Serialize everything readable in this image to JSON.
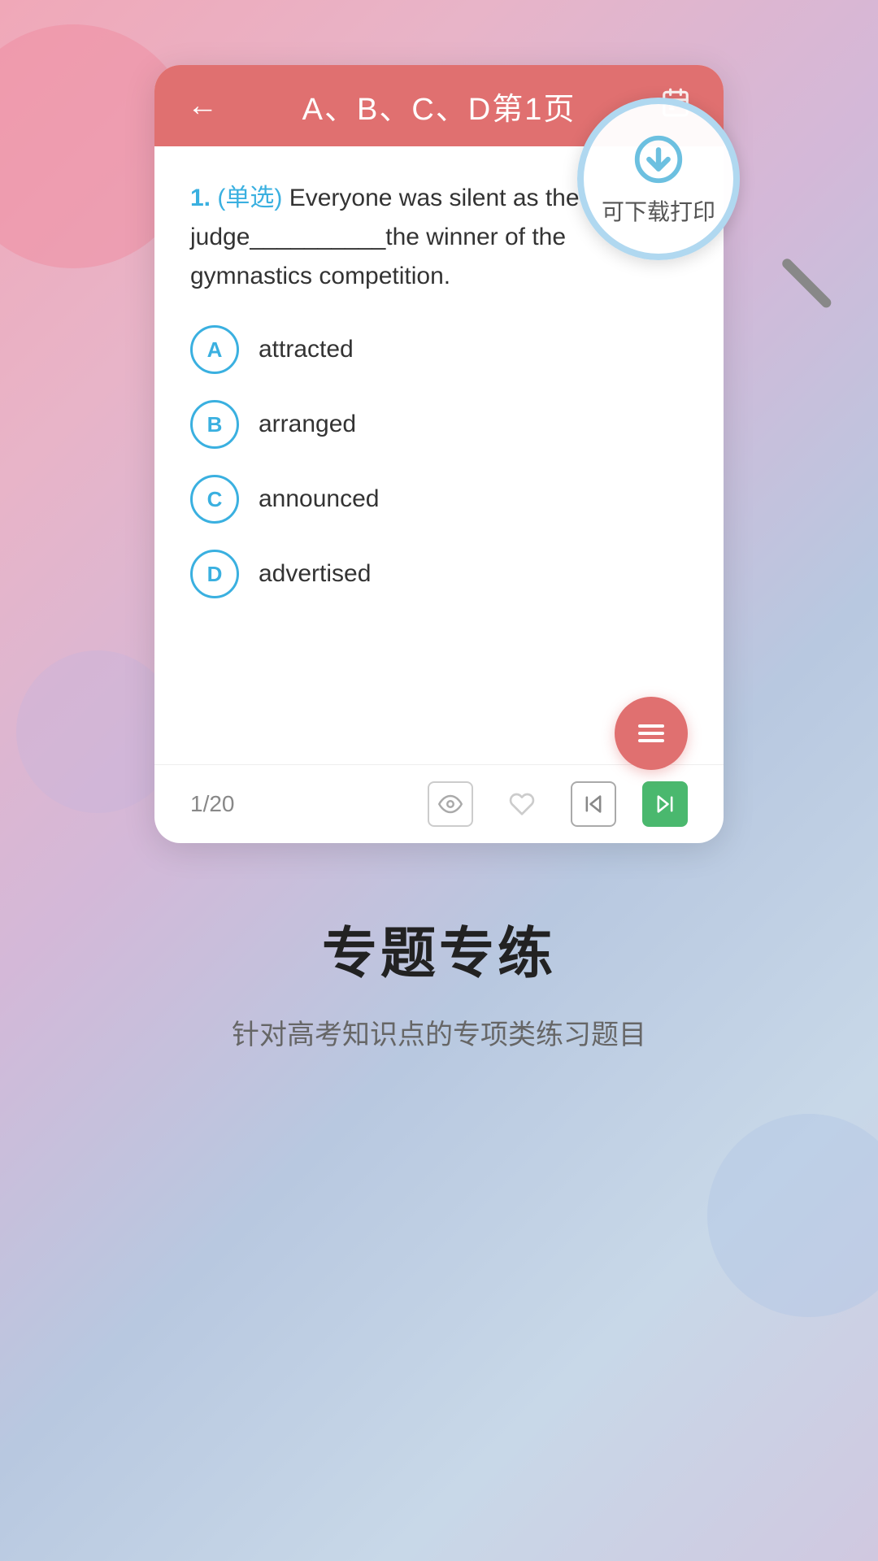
{
  "header": {
    "back_label": "←",
    "title": "A、B、C、D第1页",
    "calendar_icon": "📅",
    "download_icon": "⬇"
  },
  "magnifier": {
    "label": "可下载打印"
  },
  "question": {
    "number": "1.",
    "type": "(单选)",
    "text": " Everyone was silent as the judge__________the winner of the gymnastics competition."
  },
  "options": [
    {
      "letter": "A",
      "text": "attracted"
    },
    {
      "letter": "B",
      "text": "arranged"
    },
    {
      "letter": "C",
      "text": "announced"
    },
    {
      "letter": "D",
      "text": "advertised"
    }
  ],
  "footer": {
    "page_count": "1/20",
    "eye_icon": "👁",
    "heart_icon": "♡",
    "prev_icon": "⏮",
    "next_icon": "⏭"
  },
  "bottom_section": {
    "title": "专题专练",
    "subtitle": "针对高考知识点的专项类练习题目"
  }
}
